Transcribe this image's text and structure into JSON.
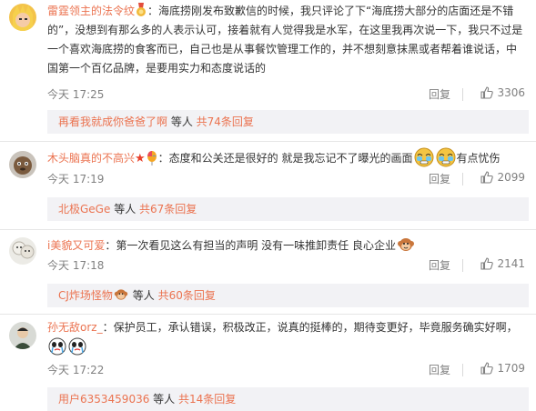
{
  "comments": [
    {
      "username": "雷霆领主的法令纹",
      "text": "：海底捞刚发布致歉信的时候，我只评论了下“海底捞大部分的店面还是不错的”，没想到有那么多的人表示认可，接着就有人觉得我是水军，在这里我再次说一下，我只不过是一个喜欢海底捞的食客而已，自己也是从事餐饮管理工作的，并不想刻意抹黑或者帮着谁说话，中国第一个百亿品牌，是要用实力和态度说话的",
      "time": "今天 17:25",
      "reply_label": "回复",
      "likes": "3306",
      "sub_reply": {
        "name": "再看我就成你爸爸了啊",
        "mid": " 等人 ",
        "count": "共74条回复"
      }
    },
    {
      "username": "木头脑真的不高兴",
      "text_a": "：态度和公关还是很好的 就是我忘记不了曝光的画面",
      "text_b": "有点忧伤",
      "time": "今天 17:19",
      "reply_label": "回复",
      "likes": "2099",
      "sub_reply": {
        "name": "北极GeGe",
        "mid": " 等人 ",
        "count": "共67条回复"
      }
    },
    {
      "username": "i美貌又可爱",
      "text": "：第一次看见这么有担当的声明 没有一味推卸责任 良心企业",
      "time": "今天 17:18",
      "reply_label": "回复",
      "likes": "2141",
      "sub_reply": {
        "name": "CJ炸场怪物",
        "mid": " 等人 ",
        "count": "共60条回复"
      }
    },
    {
      "username": "孙无敌orz_",
      "text": "：保护员工，承认错误，积极改正，说真的挺棒的，期待变更好，毕竟服务确实好啊，",
      "time": "今天 17:22",
      "reply_label": "回复",
      "likes": "1709",
      "sub_reply": {
        "name": "用户6353459036",
        "mid": " 等人 ",
        "count": "共14条回复"
      }
    }
  ],
  "colors": {
    "link": "#eb7350",
    "meta": "#808080",
    "subreply_bg": "#f2f2f5"
  }
}
